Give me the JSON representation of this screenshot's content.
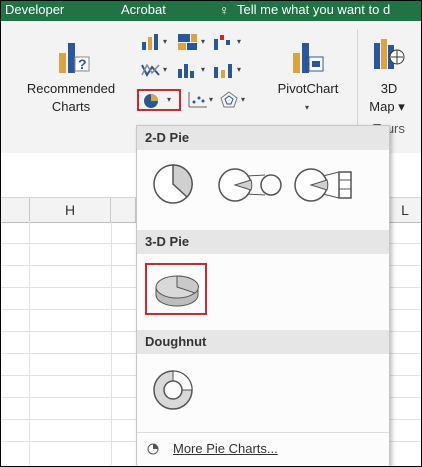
{
  "tabs": [
    "Developer",
    "Acrobat",
    "Tell me what you want to d"
  ],
  "ribbon": {
    "recommended_line1": "Recommended",
    "recommended_line2": "Charts",
    "pivotchart_label": "PivotChart",
    "map3d_line1": "3D",
    "map3d_line2": "Map",
    "tours_label": "Tours"
  },
  "columns": [
    "H",
    "L"
  ],
  "menu": {
    "section_2d": "2-D Pie",
    "section_3d": "3-D Pie",
    "section_doughnut": "Doughnut",
    "more_label": "More Pie Charts..."
  },
  "colors": {
    "ribbon_tab": "#217346",
    "highlight": "#d0282b",
    "pie_blue": "#2b579a"
  }
}
